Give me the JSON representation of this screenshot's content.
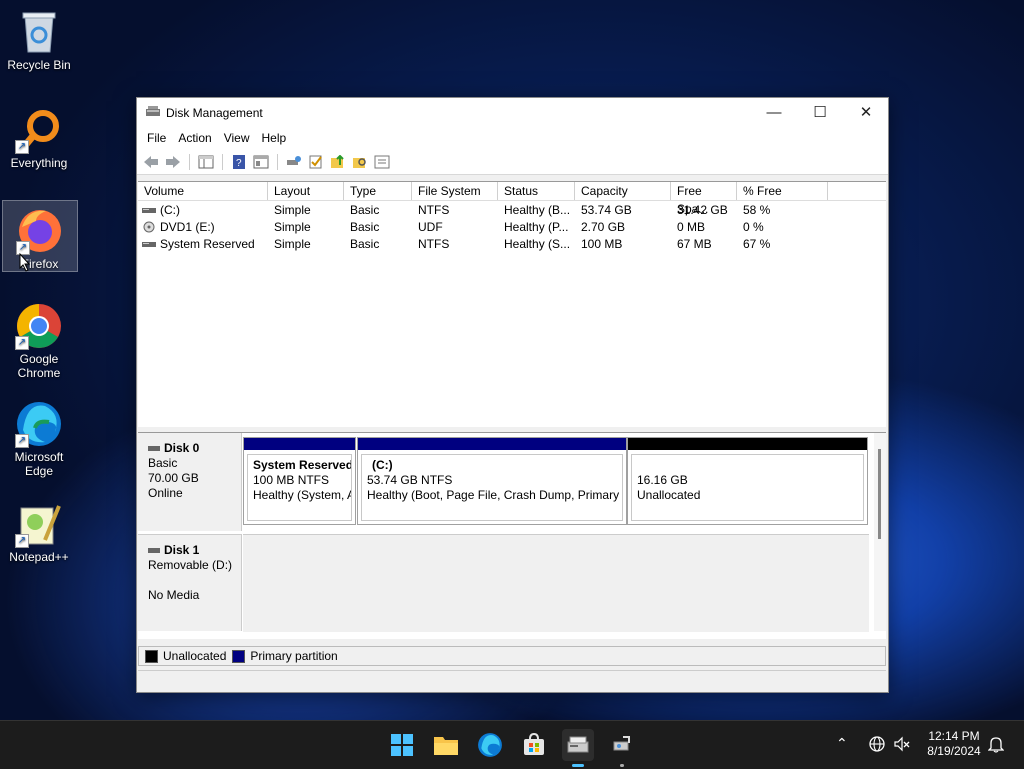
{
  "desktop": {
    "icons": [
      {
        "label": "Recycle Bin"
      },
      {
        "label": "Everything"
      },
      {
        "label": "Firefox"
      },
      {
        "label": "Google Chrome"
      },
      {
        "label": "Microsoft Edge"
      },
      {
        "label": "Notepad++"
      }
    ]
  },
  "window": {
    "title": "Disk Management",
    "menu": [
      "File",
      "Action",
      "View",
      "Help"
    ]
  },
  "volumes": {
    "columns": [
      "Volume",
      "Layout",
      "Type",
      "File System",
      "Status",
      "Capacity",
      "Free Spa...",
      "% Free"
    ],
    "rows": [
      [
        "(C:)",
        "Simple",
        "Basic",
        "NTFS",
        "Healthy (B...",
        "53.74 GB",
        "31.42 GB",
        "58 %"
      ],
      [
        "DVD1 (E:)",
        "Simple",
        "Basic",
        "UDF",
        "Healthy (P...",
        "2.70 GB",
        "0 MB",
        "0 %"
      ],
      [
        "System Reserved",
        "Simple",
        "Basic",
        "NTFS",
        "Healthy (S...",
        "100 MB",
        "67 MB",
        "67 %"
      ]
    ]
  },
  "disks": {
    "disk0": {
      "name": "Disk 0",
      "type": "Basic",
      "size": "70.00 GB",
      "status": "Online",
      "partitions": [
        {
          "name": "System Reserved",
          "size": "100 MB NTFS",
          "status": "Healthy (System, A"
        },
        {
          "name": "(C:)",
          "size": "53.74 GB NTFS",
          "status": "Healthy (Boot, Page File, Crash Dump, Primary P"
        },
        {
          "name": "",
          "size": "16.16 GB",
          "status": "Unallocated"
        }
      ]
    },
    "disk1": {
      "name": "Disk 1",
      "type": "Removable (D:)",
      "status": "No Media"
    }
  },
  "legend": {
    "unallocated": "Unallocated",
    "primary": "Primary partition"
  },
  "colors": {
    "primary": "#000080",
    "unallocated": "#000000"
  },
  "tray": {
    "time": "12:14 PM",
    "date": "8/19/2024"
  }
}
